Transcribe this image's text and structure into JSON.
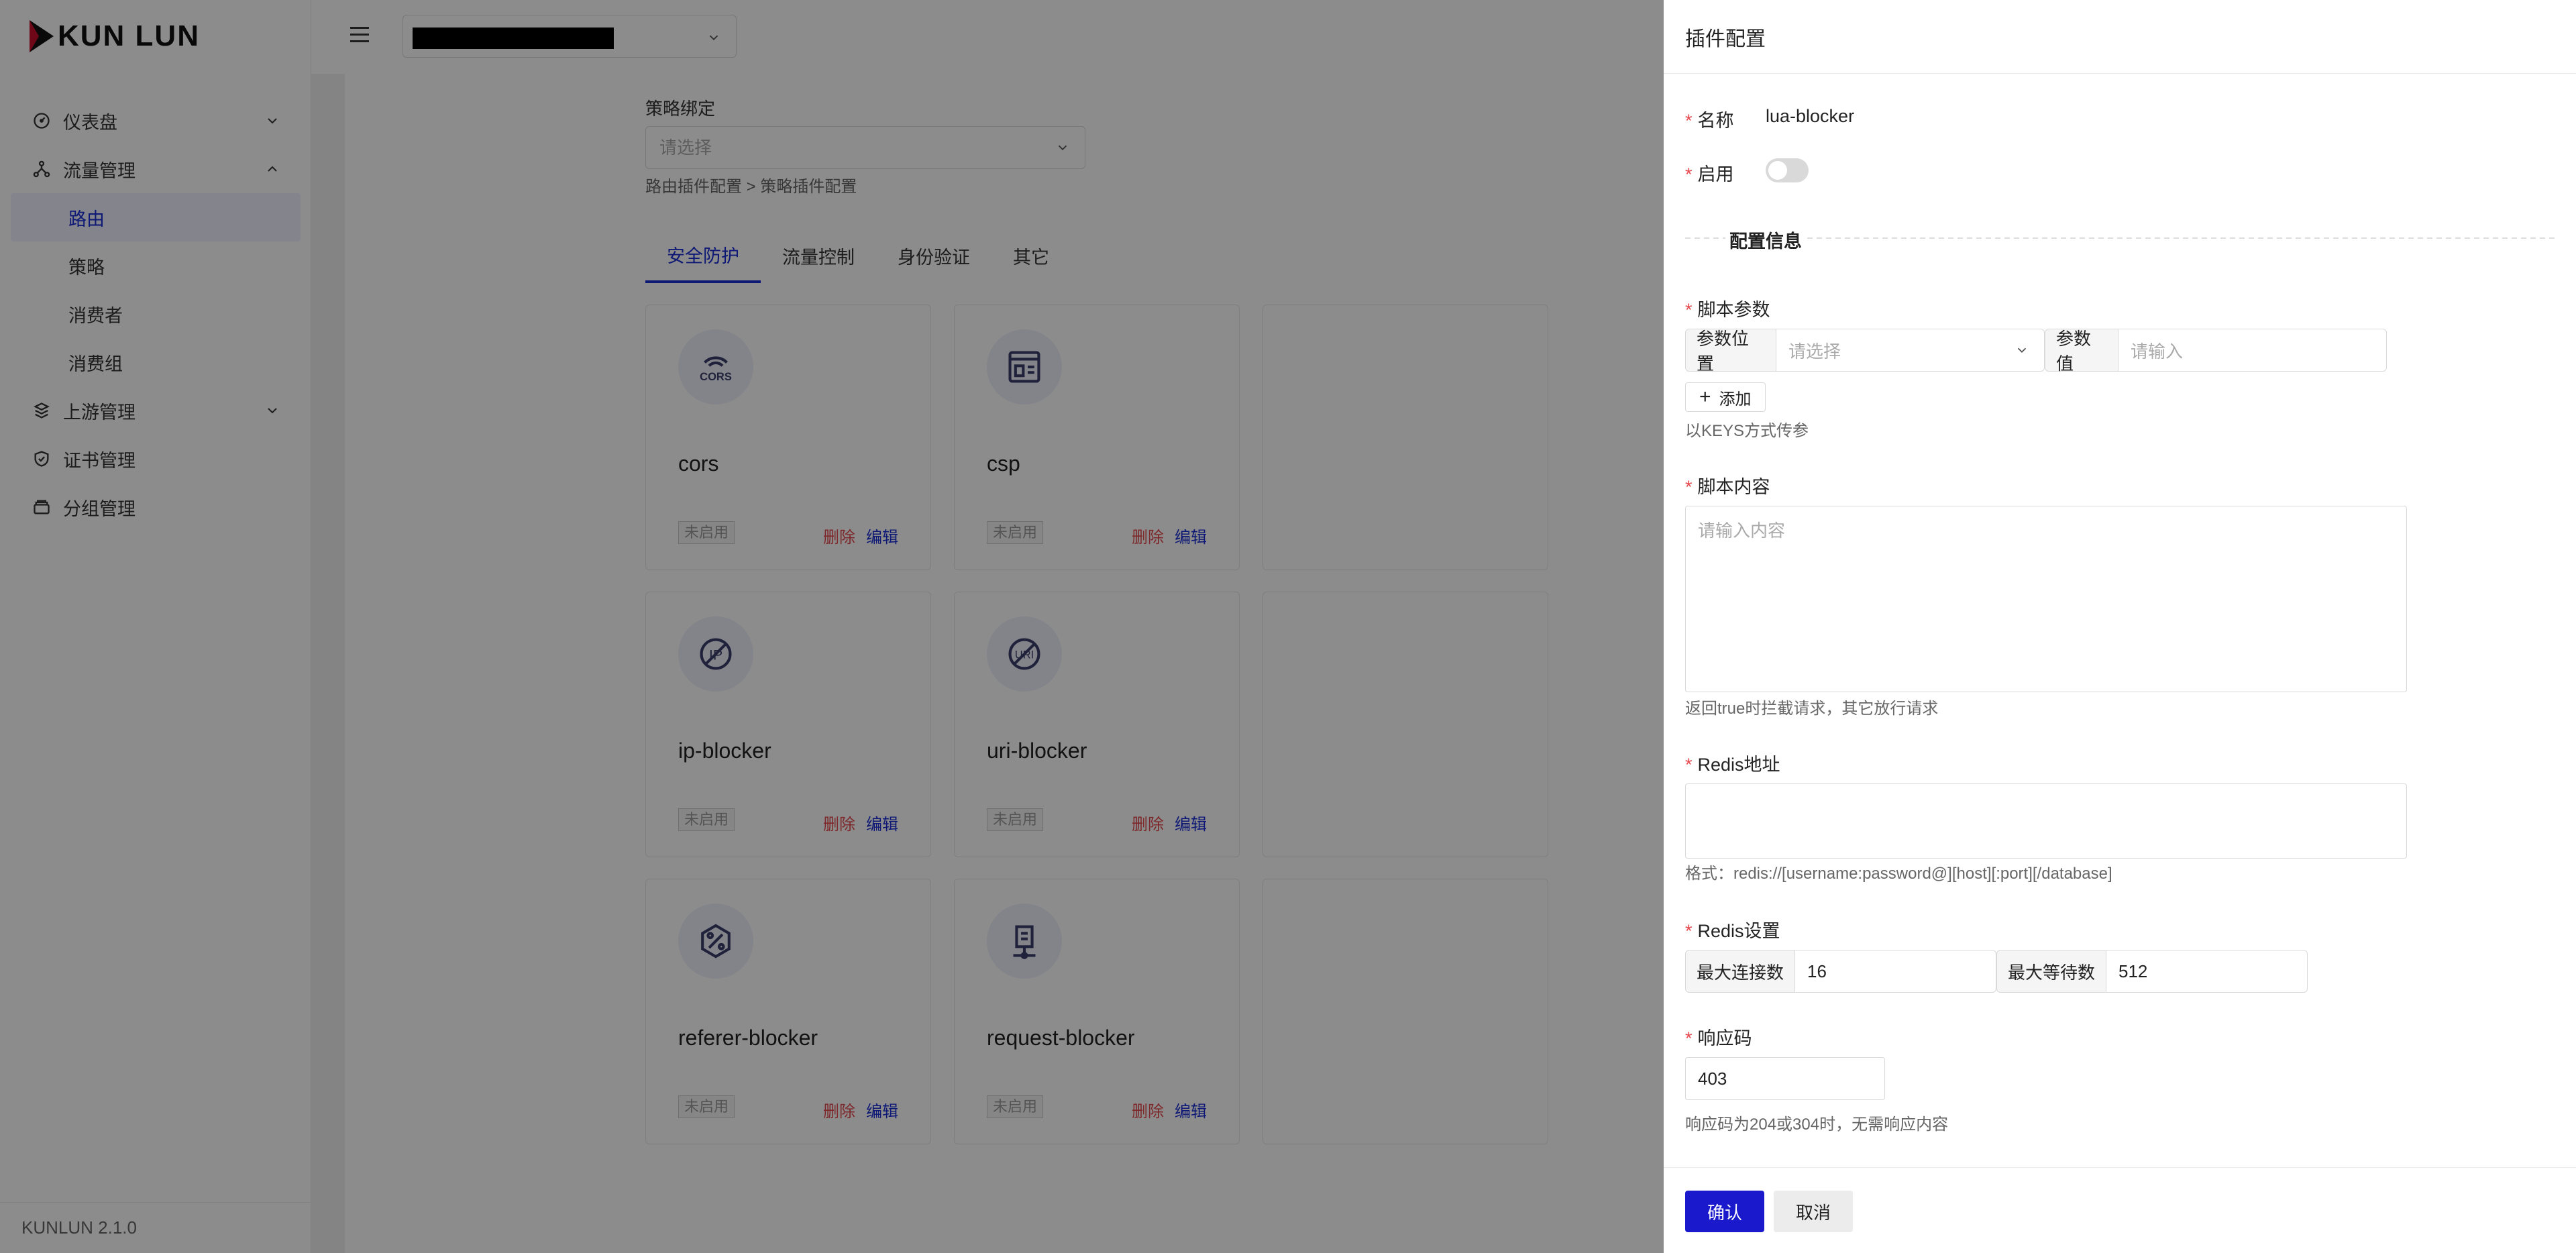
{
  "app": {
    "logo": "KUN LUN",
    "version": "KUNLUN 2.1.0"
  },
  "sidebar": {
    "items": [
      {
        "label": "仪表盘",
        "icon": "dashboard-icon",
        "expanded": false
      },
      {
        "label": "流量管理",
        "icon": "traffic-icon",
        "expanded": true,
        "children": [
          {
            "label": "路由",
            "active": true
          },
          {
            "label": "策略"
          },
          {
            "label": "消费者"
          },
          {
            "label": "消费组"
          }
        ]
      },
      {
        "label": "上游管理",
        "icon": "upstream-icon",
        "expanded": false
      },
      {
        "label": "证书管理",
        "icon": "certificate-icon"
      },
      {
        "label": "分组管理",
        "icon": "group-icon"
      }
    ]
  },
  "main": {
    "strategy_label": "策略绑定",
    "strategy_placeholder": "请选择",
    "breadcrumb": "路由插件配置 > 策略插件配置",
    "tabs": [
      "安全防护",
      "流量控制",
      "身份验证",
      "其它"
    ],
    "active_tab": 0,
    "cards": [
      {
        "name": "cors",
        "icon": "cors-icon",
        "status": "未启用",
        "delete": "删除",
        "edit": "编辑"
      },
      {
        "name": "csp",
        "icon": "window-icon",
        "status": "未启用",
        "delete": "删除",
        "edit": "编辑"
      },
      {
        "name": "ip-blocker",
        "icon": "ip-blocked-icon",
        "status": "未启用",
        "delete": "删除",
        "edit": "编辑"
      },
      {
        "name": "uri-blocker",
        "icon": "uri-blocked-icon",
        "status": "未启用",
        "delete": "删除",
        "edit": "编辑"
      },
      {
        "name": "referer-blocker",
        "icon": "percent-hexagon-icon",
        "status": "未启用",
        "delete": "删除",
        "edit": "编辑"
      },
      {
        "name": "request-blocker",
        "icon": "request-block-icon",
        "status": "未启用",
        "delete": "删除",
        "edit": "编辑"
      }
    ]
  },
  "drawer": {
    "title": "插件配置",
    "name_label": "名称",
    "name_value": "lua-blocker",
    "enable_label": "启用",
    "enabled": false,
    "section_title": "配置信息",
    "script_params": {
      "label": "脚本参数",
      "position_addon": "参数位置",
      "position_placeholder": "请选择",
      "value_addon": "参数值",
      "value_placeholder": "请输入",
      "add_label": "添加",
      "help": "以KEYS方式传参"
    },
    "script_content": {
      "label": "脚本内容",
      "placeholder": "请输入内容",
      "help": "返回true时拦截请求，其它放行请求"
    },
    "redis_address": {
      "label": "Redis地址",
      "help": "格式：redis://[username:password@][host][:port][/database]"
    },
    "redis_settings": {
      "label": "Redis设置",
      "max_conn_addon": "最大连接数",
      "max_conn_value": "16",
      "max_wait_addon": "最大等待数",
      "max_wait_value": "512"
    },
    "response_code": {
      "label": "响应码",
      "value": "403",
      "help": "响应码为204或304时，无需响应内容"
    },
    "confirm_label": "确认",
    "cancel_label": "取消"
  },
  "colors": {
    "accent": "#1a2ed6",
    "danger": "#e5484d",
    "primary_button": "#1a1acc"
  }
}
